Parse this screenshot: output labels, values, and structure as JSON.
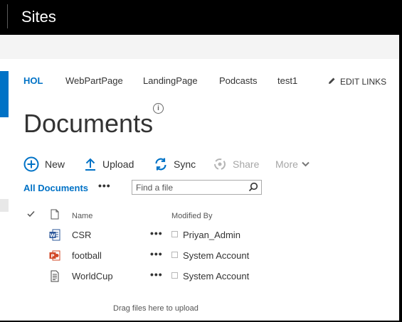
{
  "window": {
    "title": "Sites"
  },
  "nav": {
    "links": [
      "HOL",
      "WebPartPage",
      "LandingPage",
      "Podcasts",
      "test1"
    ],
    "edit_links": "EDIT LINKS"
  },
  "page": {
    "title": "Documents"
  },
  "commands": {
    "new": "New",
    "upload": "Upload",
    "sync": "Sync",
    "share": "Share",
    "more": "More"
  },
  "view": {
    "current": "All Documents",
    "more_glyph": "•••",
    "search_placeholder": "Find a file"
  },
  "table": {
    "columns": {
      "name": "Name",
      "modified_by": "Modified By"
    },
    "rows": [
      {
        "name": "CSR",
        "type": "word-doc-icon",
        "modified_by": "Priyan_Admin"
      },
      {
        "name": "football",
        "type": "powerpoint-icon",
        "modified_by": "System Account"
      },
      {
        "name": "WorldCup",
        "type": "generic-doc-icon",
        "modified_by": "System Account"
      }
    ],
    "row_menu": "•••"
  },
  "drop_hint": "Drag files here to upload",
  "colors": {
    "accent": "#0072c6",
    "topbar": "#000000",
    "suitebar": "#f4f4f4"
  }
}
